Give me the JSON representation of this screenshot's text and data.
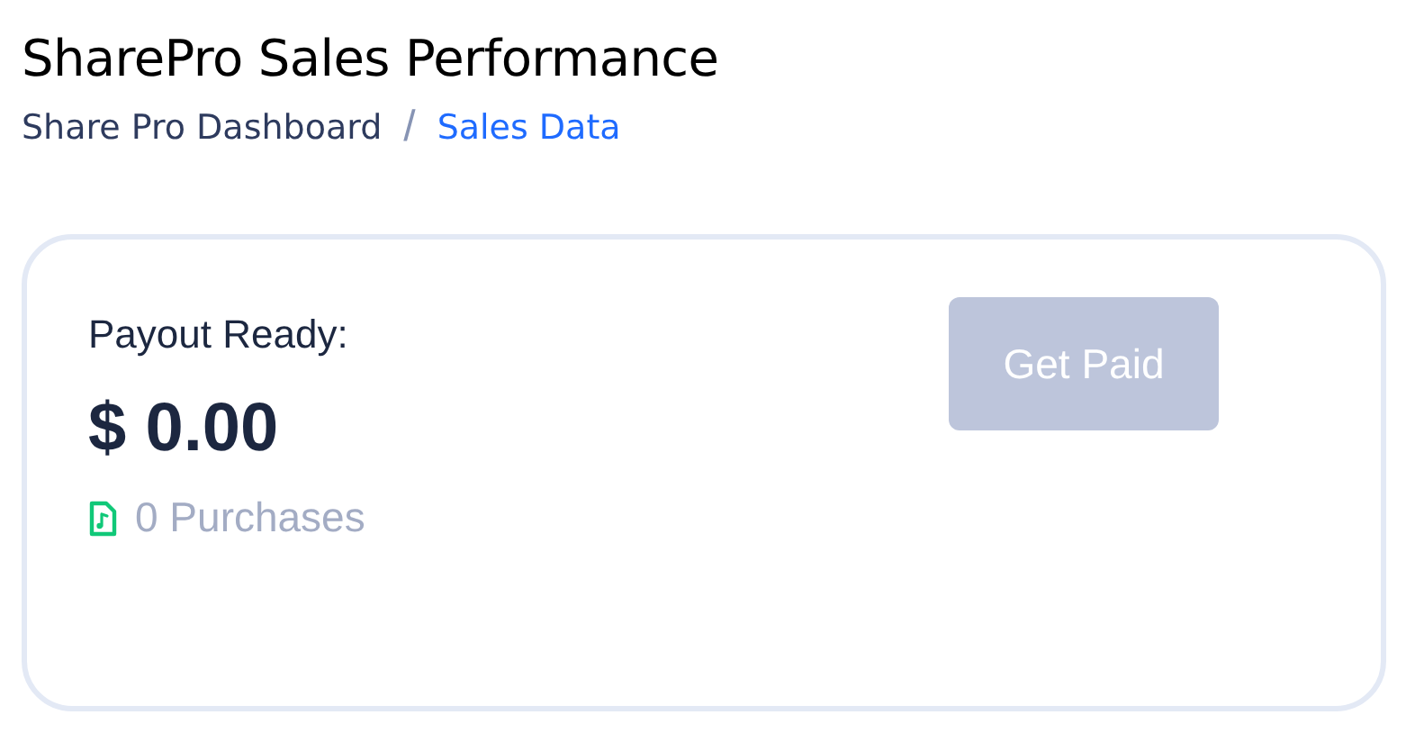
{
  "page_title": "SharePro Sales Performance",
  "breadcrumb": [
    {
      "label": "Share Pro Dashboard",
      "selected": false
    },
    {
      "label": "Sales Data",
      "selected": true
    }
  ],
  "breadcrumb_separator": "/",
  "payout_card": {
    "label": "Payout Ready:",
    "amount": "$ 0.00",
    "purchases": "0 Purchases",
    "button": {
      "label": "Get Paid",
      "disabled": true
    }
  }
}
